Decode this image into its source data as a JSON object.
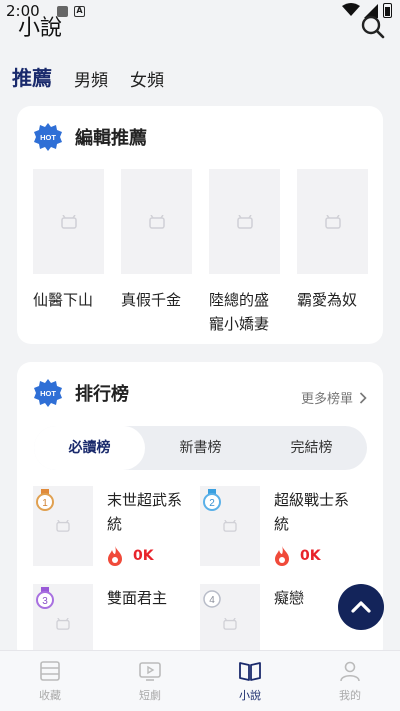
{
  "status": {
    "time": "2:00"
  },
  "header": {
    "title": "小說"
  },
  "top_tabs": [
    {
      "label": "推薦",
      "active": true
    },
    {
      "label": "男頻",
      "active": false
    },
    {
      "label": "女頻",
      "active": false
    }
  ],
  "editor_section": {
    "badge": "HOT",
    "title": "編輯推薦",
    "books": [
      {
        "title": "仙醫下山"
      },
      {
        "title": "真假千金"
      },
      {
        "title": "陸總的盛寵小嬌妻"
      },
      {
        "title": "霸愛為奴"
      }
    ]
  },
  "ranking_section": {
    "badge": "HOT",
    "title": "排行榜",
    "more_label": "更多榜單",
    "segments": [
      {
        "label": "必讀榜",
        "active": true
      },
      {
        "label": "新書榜",
        "active": false
      },
      {
        "label": "完結榜",
        "active": false
      }
    ],
    "items": [
      {
        "rank": "1",
        "title": "末世超武系統",
        "count": "0K"
      },
      {
        "rank": "2",
        "title": "超級戰士系統",
        "count": "0K"
      },
      {
        "rank": "3",
        "title": "雙面君主",
        "count": ""
      },
      {
        "rank": "4",
        "title": "癡戀",
        "count": ""
      }
    ]
  },
  "bottom_nav": [
    {
      "label": "收藏",
      "icon": "bookshelf-icon",
      "active": false
    },
    {
      "label": "短劇",
      "icon": "tv-icon",
      "active": false
    },
    {
      "label": "小說",
      "icon": "book-icon",
      "active": true
    },
    {
      "label": "我的",
      "icon": "person-icon",
      "active": false
    }
  ],
  "colors": {
    "accent": "#1a2a6c",
    "hot": "#2f6fd6",
    "count_red": "#e8232b",
    "fab": "#13245a"
  }
}
